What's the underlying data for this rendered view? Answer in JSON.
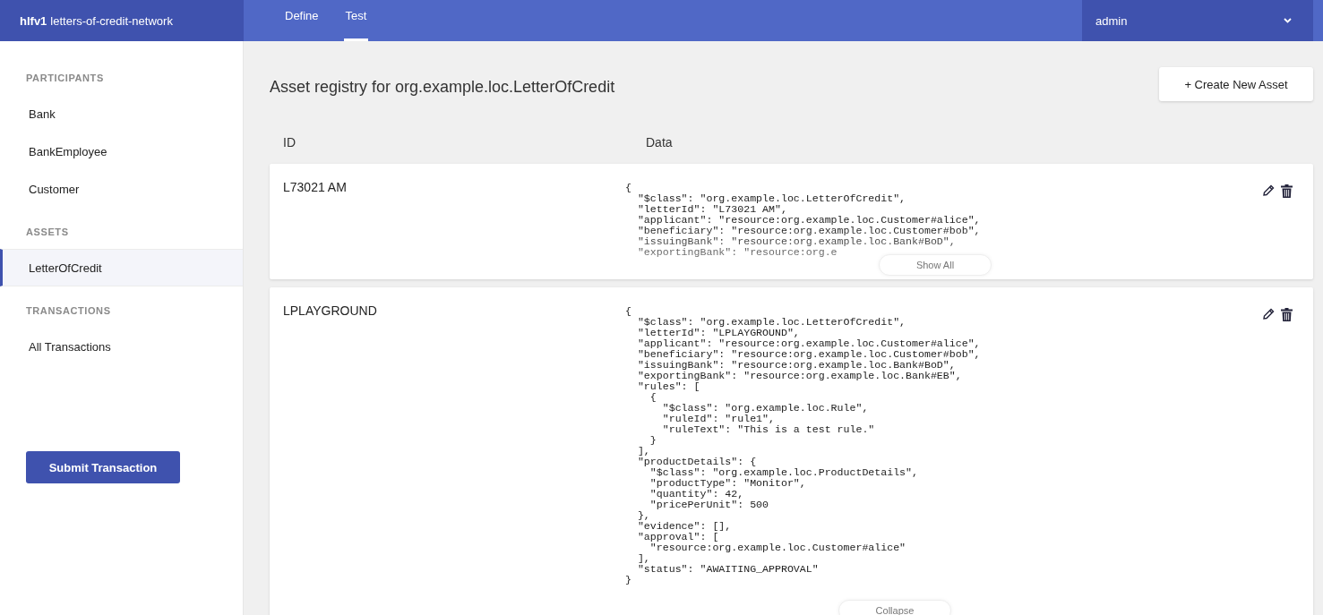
{
  "header": {
    "version": "hlfv1",
    "network": "letters-of-credit-network",
    "tabs": [
      {
        "label": "Define",
        "selected": false
      },
      {
        "label": "Test",
        "selected": true
      }
    ],
    "user": "admin"
  },
  "sidebar": {
    "sections": [
      {
        "title": "PARTICIPANTS",
        "items": [
          {
            "label": "Bank",
            "selected": false
          },
          {
            "label": "BankEmployee",
            "selected": false
          },
          {
            "label": "Customer",
            "selected": false
          }
        ]
      },
      {
        "title": "ASSETS",
        "items": [
          {
            "label": "LetterOfCredit",
            "selected": true
          }
        ]
      },
      {
        "title": "TRANSACTIONS",
        "items": [
          {
            "label": "All Transactions",
            "selected": false
          }
        ]
      }
    ],
    "submit_button": "Submit Transaction"
  },
  "registry": {
    "title": "Asset registry for org.example.loc.LetterOfCredit",
    "create_button": "+ Create New Asset",
    "columns": [
      "ID",
      "Data"
    ],
    "rows": [
      {
        "id": "L73021 AM",
        "expanded": false,
        "toggle": "Show All",
        "data_lines": [
          "{",
          "  \"$class\": \"org.example.loc.LetterOfCredit\",",
          "  \"letterId\": \"L73021 AM\",",
          "  \"applicant\": \"resource:org.example.loc.Customer#alice\",",
          "  \"beneficiary\": \"resource:org.example.loc.Customer#bob\",",
          "  \"issuingBank\": \"resource:org.example.loc.Bank#BoD\",",
          "  \"exportingBank\": \"resource:org.e"
        ]
      },
      {
        "id": "LPLAYGROUND",
        "expanded": true,
        "toggle": "Collapse",
        "data_lines": [
          "{",
          "  \"$class\": \"org.example.loc.LetterOfCredit\",",
          "  \"letterId\": \"LPLAYGROUND\",",
          "  \"applicant\": \"resource:org.example.loc.Customer#alice\",",
          "  \"beneficiary\": \"resource:org.example.loc.Customer#bob\",",
          "  \"issuingBank\": \"resource:org.example.loc.Bank#BoD\",",
          "  \"exportingBank\": \"resource:org.example.loc.Bank#EB\",",
          "  \"rules\": [",
          "    {",
          "      \"$class\": \"org.example.loc.Rule\",",
          "      \"ruleId\": \"rule1\",",
          "      \"ruleText\": \"This is a test rule.\"",
          "    }",
          "  ],",
          "  \"productDetails\": {",
          "    \"$class\": \"org.example.loc.ProductDetails\",",
          "    \"productType\": \"Monitor\",",
          "    \"quantity\": 42,",
          "    \"pricePerUnit\": 500",
          "  },",
          "  \"evidence\": [],",
          "  \"approval\": [",
          "    \"resource:org.example.loc.Customer#alice\"",
          "  ],",
          "  \"status\": \"AWAITING_APPROVAL\"",
          "}"
        ]
      }
    ]
  }
}
